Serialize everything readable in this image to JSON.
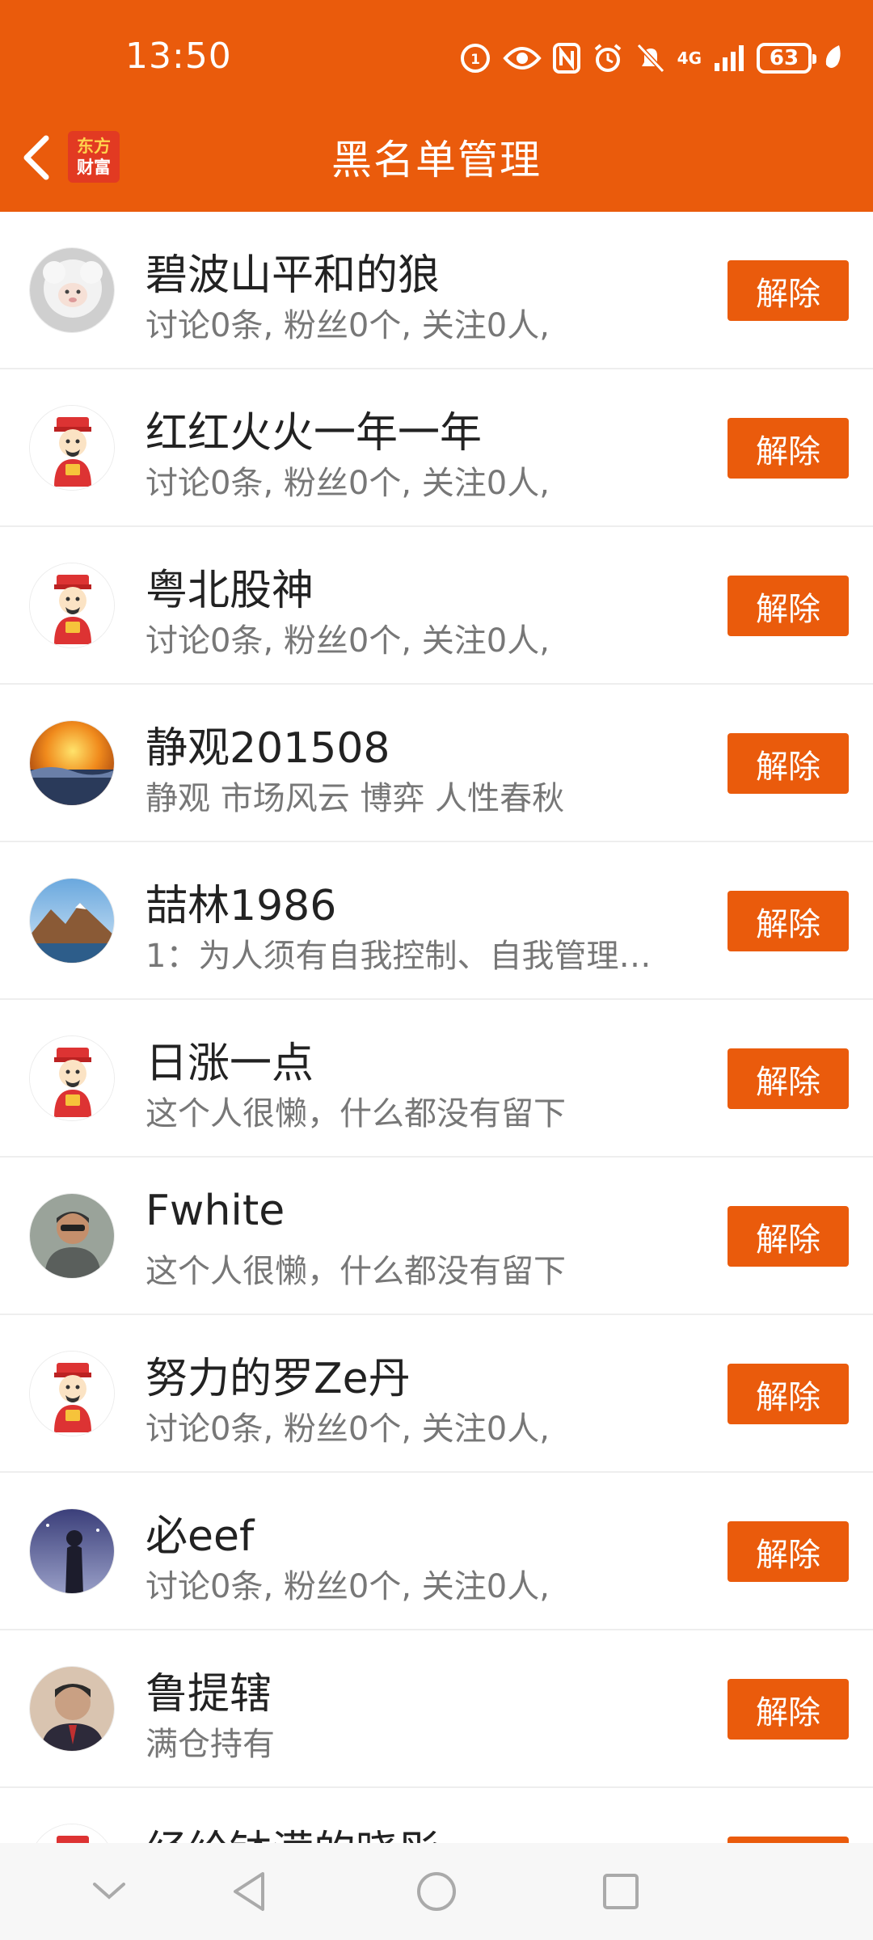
{
  "status_bar": {
    "time": "13:50",
    "network": "4G",
    "battery": "63",
    "icons": [
      "hd-icon",
      "eye-icon",
      "nfc-icon",
      "alarm-icon",
      "mute-icon",
      "signal-icon",
      "battery-icon",
      "leaf-icon"
    ]
  },
  "header": {
    "title": "黑名单管理",
    "logo_line1": "东方",
    "logo_line2": "财富",
    "back_icon": "chevron-left-icon"
  },
  "blacklist": {
    "remove_label": "解除",
    "items": [
      {
        "name": "碧波山平和的狼",
        "desc": "讨论0条, 粉丝0个, 关注0人,",
        "avatar": "sheep"
      },
      {
        "name": "红红火火一年一年",
        "desc": "讨论0条, 粉丝0个, 关注0人,",
        "avatar": "caishen"
      },
      {
        "name": "粤北股神",
        "desc": "讨论0条, 粉丝0个, 关注0人,",
        "avatar": "caishen"
      },
      {
        "name": "静观201508",
        "desc": "静观 市场风云 博弈 人性春秋",
        "avatar": "sunset"
      },
      {
        "name": "喆林1986",
        "desc": "1：为人须有自我控制、自我管理…",
        "avatar": "mountain"
      },
      {
        "name": "日涨一点",
        "desc": "这个人很懒，什么都没有留下",
        "avatar": "caishen"
      },
      {
        "name": "Fwhite",
        "desc": "这个人很懒，什么都没有留下",
        "avatar": "man"
      },
      {
        "name": "努力的罗Ze丹",
        "desc": "讨论0条, 粉丝0个, 关注0人,",
        "avatar": "caishen"
      },
      {
        "name": "必eef",
        "desc": "讨论0条, 粉丝0个, 关注0人,",
        "avatar": "night"
      },
      {
        "name": "鲁提辖",
        "desc": "满仓持有",
        "avatar": "portrait"
      },
      {
        "name": "经纶钵满的晓彤",
        "desc": "",
        "avatar": "caishen"
      }
    ]
  },
  "nav_bar": {
    "icons": [
      "chevron-down-icon",
      "back-triangle-icon",
      "home-circle-icon",
      "recents-square-icon"
    ]
  },
  "colors": {
    "brand": "#ea5b0c",
    "text_primary": "#222222",
    "text_secondary": "#777777"
  }
}
